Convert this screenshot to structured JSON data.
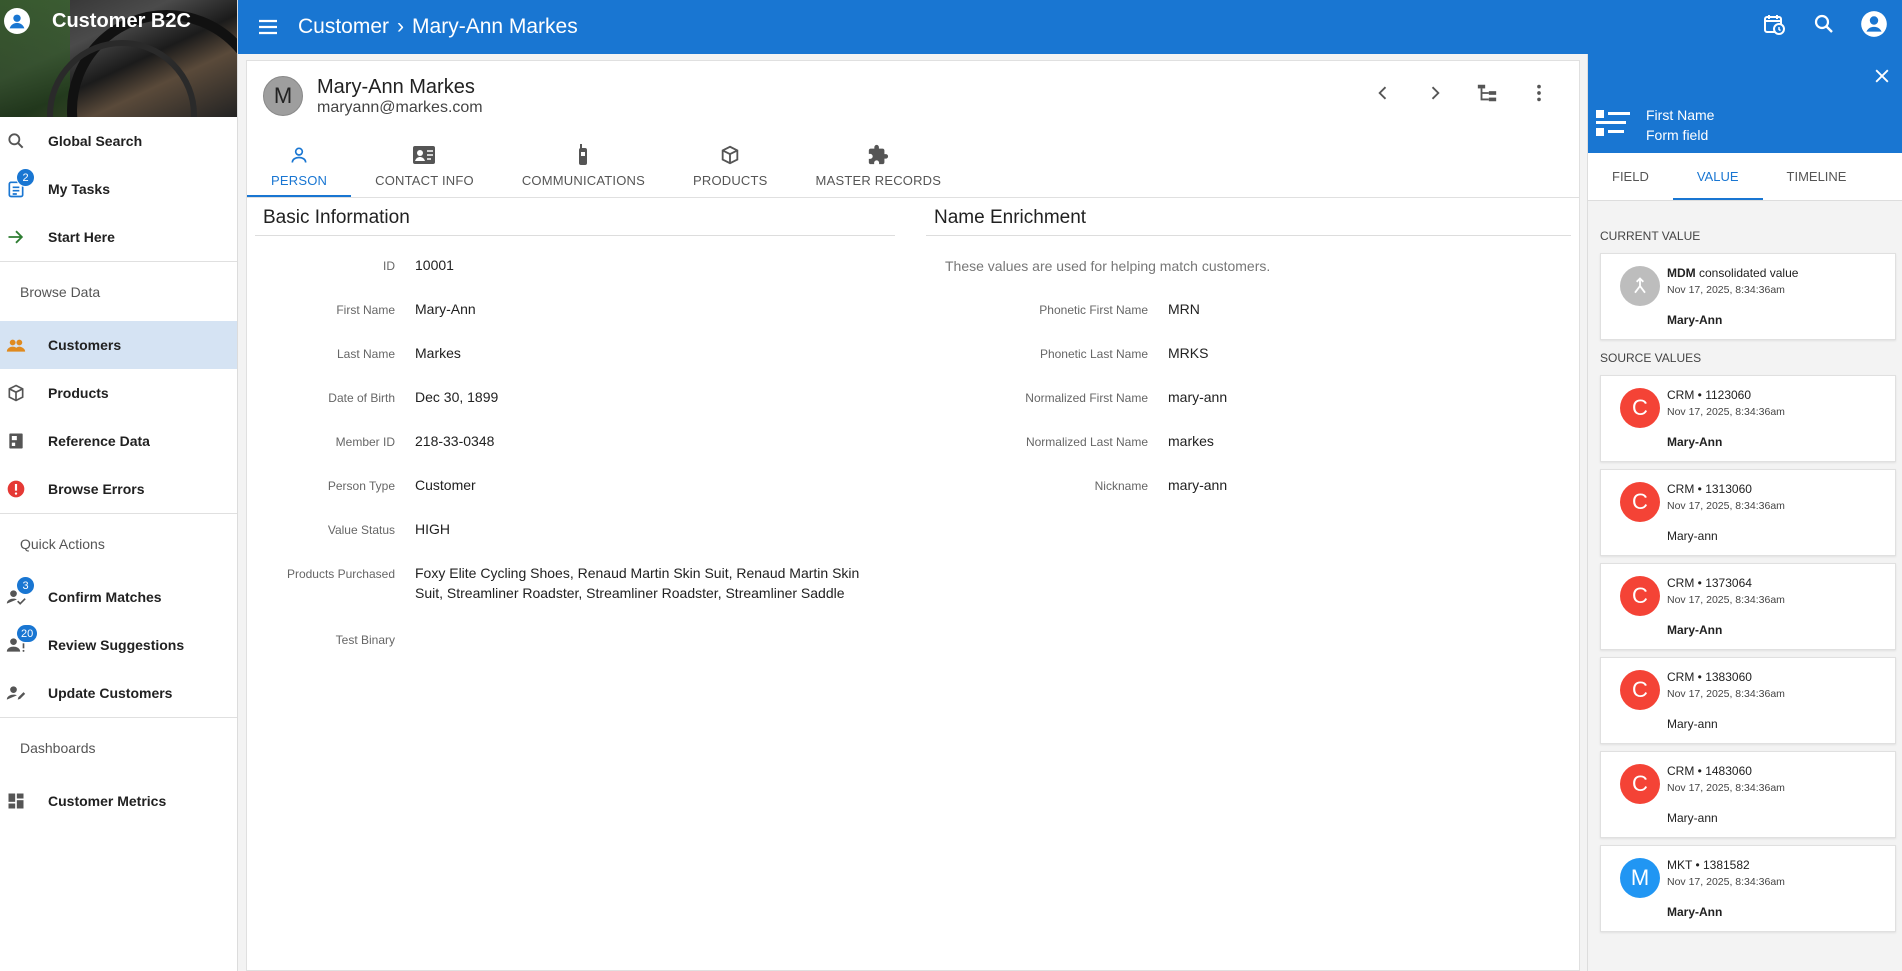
{
  "app": {
    "title": "Customer B2C"
  },
  "sidebar": {
    "items_top": [
      {
        "label": "Global Search",
        "icon": "search-icon"
      },
      {
        "label": "My Tasks",
        "icon": "tasks-icon",
        "badge": "2"
      },
      {
        "label": "Start Here",
        "icon": "arrow-right-icon"
      }
    ],
    "browse_data_heading": "Browse Data",
    "browse_items": [
      {
        "label": "Customers",
        "icon": "people-icon",
        "active": true
      },
      {
        "label": "Products",
        "icon": "box-icon"
      },
      {
        "label": "Reference Data",
        "icon": "reference-icon"
      },
      {
        "label": "Browse Errors",
        "icon": "error-icon"
      }
    ],
    "quick_actions_heading": "Quick Actions",
    "quick_items": [
      {
        "label": "Confirm Matches",
        "icon": "person-check-icon",
        "badge": "3"
      },
      {
        "label": "Review Suggestions",
        "icon": "person-alert-icon",
        "badge": "20"
      },
      {
        "label": "Update Customers",
        "icon": "person-edit-icon"
      }
    ],
    "dashboards_heading": "Dashboards",
    "dash_items": [
      {
        "label": "Customer Metrics",
        "icon": "dashboard-icon"
      }
    ]
  },
  "topbar": {
    "breadcrumb_root": "Customer",
    "breadcrumb_sep": "›",
    "breadcrumb_current": "Mary-Ann Markes"
  },
  "record": {
    "avatar_letter": "M",
    "name": "Mary-Ann Markes",
    "email": "maryann@markes.com"
  },
  "tabs": [
    "PERSON",
    "CONTACT INFO",
    "COMMUNICATIONS",
    "PRODUCTS",
    "MASTER RECORDS"
  ],
  "basic": {
    "title": "Basic Information",
    "fields": [
      {
        "label": "ID",
        "value": "10001"
      },
      {
        "label": "First Name",
        "value": "Mary-Ann"
      },
      {
        "label": "Last Name",
        "value": "Markes"
      },
      {
        "label": "Date of Birth",
        "value": "Dec 30, 1899"
      },
      {
        "label": "Member ID",
        "value": "218-33-0348"
      },
      {
        "label": "Person Type",
        "value": "Customer"
      },
      {
        "label": "Value Status",
        "value": "HIGH"
      },
      {
        "label": "Products Purchased",
        "value": "Foxy Elite Cycling Shoes, Renaud Martin Skin Suit, Renaud Martin Skin Suit, Streamliner Roadster, Streamliner Roadster, Streamliner Saddle"
      },
      {
        "label": "Test Binary",
        "value": ""
      }
    ]
  },
  "enrichment": {
    "title": "Name Enrichment",
    "hint": "These values are used for helping match customers.",
    "fields": [
      {
        "label": "Phonetic First Name",
        "value": "MRN"
      },
      {
        "label": "Phonetic Last Name",
        "value": "MRKS"
      },
      {
        "label": "Normalized First Name",
        "value": "mary-ann"
      },
      {
        "label": "Normalized Last Name",
        "value": "markes"
      },
      {
        "label": "Nickname",
        "value": "mary-ann"
      }
    ]
  },
  "panel": {
    "field_name": "First Name",
    "field_type": "Form field",
    "tabs": [
      "FIELD",
      "VALUE",
      "TIMELINE"
    ],
    "current_value_label": "CURRENT VALUE",
    "current": {
      "source_bold": "MDM",
      "source_rest": " consolidated value",
      "timestamp": "Nov 17, 2025, 8:34:36am",
      "value": "Mary-Ann"
    },
    "source_values_label": "SOURCE VALUES",
    "sources": [
      {
        "letter": "C",
        "color": "#f44336",
        "source": "CRM • 1123060",
        "timestamp": "Nov 17, 2025, 8:34:36am",
        "value": "Mary-Ann",
        "bold": true
      },
      {
        "letter": "C",
        "color": "#f44336",
        "source": "CRM • 1313060",
        "timestamp": "Nov 17, 2025, 8:34:36am",
        "value": "Mary-ann",
        "bold": false
      },
      {
        "letter": "C",
        "color": "#f44336",
        "source": "CRM • 1373064",
        "timestamp": "Nov 17, 2025, 8:34:36am",
        "value": "Mary-Ann",
        "bold": true
      },
      {
        "letter": "C",
        "color": "#f44336",
        "source": "CRM • 1383060",
        "timestamp": "Nov 17, 2025, 8:34:36am",
        "value": "Mary-ann",
        "bold": false
      },
      {
        "letter": "C",
        "color": "#f44336",
        "source": "CRM • 1483060",
        "timestamp": "Nov 17, 2025, 8:34:36am",
        "value": "Mary-ann",
        "bold": false
      },
      {
        "letter": "M",
        "color": "#2196f3",
        "source": "MKT • 1381582",
        "timestamp": "Nov 17, 2025, 8:34:36am",
        "value": "Mary-Ann",
        "bold": true
      }
    ]
  },
  "colors": {
    "primary": "#1976d2",
    "crm": "#f44336",
    "mkt": "#2196f3",
    "active_nav": "#d5e3f3"
  }
}
